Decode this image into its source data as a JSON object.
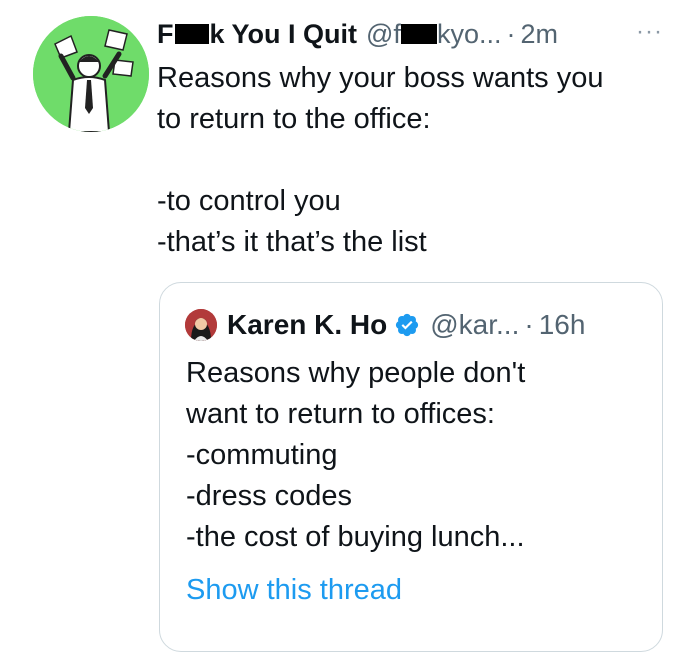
{
  "tweet": {
    "author": {
      "name_start": "F",
      "name_end": "k You I Quit",
      "handle_start": "@f",
      "handle_end": "kyo...",
      "avatar": "man-throwing-papers-avatar"
    },
    "separator": "·",
    "time": "2m",
    "more_icon": "···",
    "text_lines": [
      "Reasons why your boss wants you",
      "to return to the office:",
      "",
      "-to control you",
      "-that’s it that’s the list"
    ]
  },
  "quote": {
    "author": {
      "name": "Karen K. Ho",
      "handle": "@kar...",
      "verified": true,
      "avatar": "karen-ho-avatar"
    },
    "separator": "·",
    "time": "16h",
    "text_lines": [
      "Reasons why people don't",
      "want to return to offices:",
      "-commuting",
      "-dress codes",
      "-the cost of buying lunch..."
    ],
    "show_thread_label": "Show this thread"
  },
  "colors": {
    "link": "#1d9bf0",
    "secondary_text": "#536471",
    "avatar_bg": "#6fdc6a",
    "border": "#cfd9de"
  }
}
